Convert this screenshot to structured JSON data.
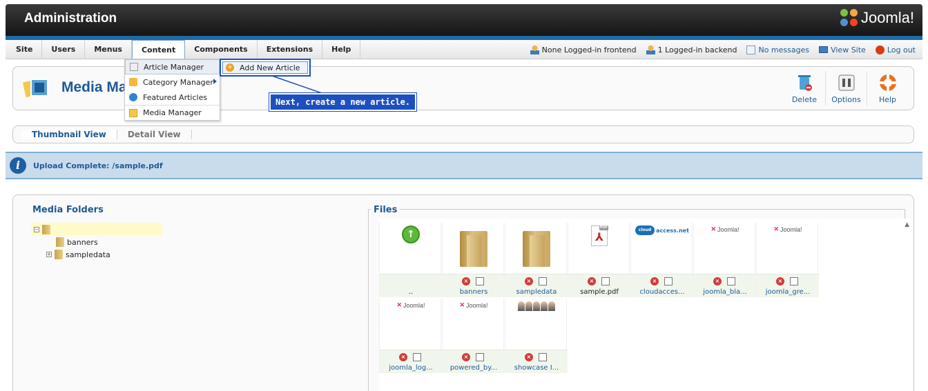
{
  "header": {
    "title": "Administration",
    "brand": "Joomla!"
  },
  "menu": {
    "items": [
      {
        "label": "Site"
      },
      {
        "label": "Users"
      },
      {
        "label": "Menus"
      },
      {
        "label": "Content"
      },
      {
        "label": "Components"
      },
      {
        "label": "Extensions"
      },
      {
        "label": "Help"
      }
    ],
    "status": {
      "frontend": "None Logged-in frontend",
      "backend": "1 Logged-in backend",
      "messages": "No messages",
      "view_site": "View Site",
      "logout": "Log out"
    }
  },
  "content_menu": {
    "items": [
      {
        "label": "Article Manager"
      },
      {
        "label": "Category Manager"
      },
      {
        "label": "Featured Articles"
      },
      {
        "label": "Media Manager"
      }
    ],
    "submenu": {
      "label": "Add New Article"
    }
  },
  "callout": {
    "text": "Next, create a new article."
  },
  "toolbar": {
    "title": "Media Ma",
    "buttons": [
      {
        "label": "Delete"
      },
      {
        "label": "Options"
      },
      {
        "label": "Help"
      }
    ]
  },
  "tabs": [
    {
      "label": "Thumbnail View"
    },
    {
      "label": "Detail View"
    }
  ],
  "message": {
    "text": "Upload Complete: /sample.pdf"
  },
  "folders": {
    "title": "Media Folders",
    "children": [
      {
        "label": "banners"
      },
      {
        "label": "sampledata"
      }
    ]
  },
  "files": {
    "title": "Files",
    "items": [
      {
        "name": "..",
        "kind": "up"
      },
      {
        "name": "banners",
        "kind": "folder"
      },
      {
        "name": "sampledata",
        "kind": "folder"
      },
      {
        "name": "sample.pdf",
        "kind": "pdf"
      },
      {
        "name": "cloudacces...",
        "kind": "cloud",
        "thumb_text": "access.net"
      },
      {
        "name": "joomla_bla...",
        "kind": "logo",
        "thumb_text": "Joomla!"
      },
      {
        "name": "joomla_gre...",
        "kind": "logo",
        "thumb_text": "Joomla!"
      },
      {
        "name": "joomla_log...",
        "kind": "logo",
        "thumb_text": "Joomla!"
      },
      {
        "name": "powered_by...",
        "kind": "logo",
        "thumb_text": "Joomla!"
      },
      {
        "name": "showcase I...",
        "kind": "people"
      }
    ]
  },
  "colors": {
    "accent": "#1d5a93",
    "header": "#1f1f1f",
    "highlight": "#1d4fbf"
  }
}
